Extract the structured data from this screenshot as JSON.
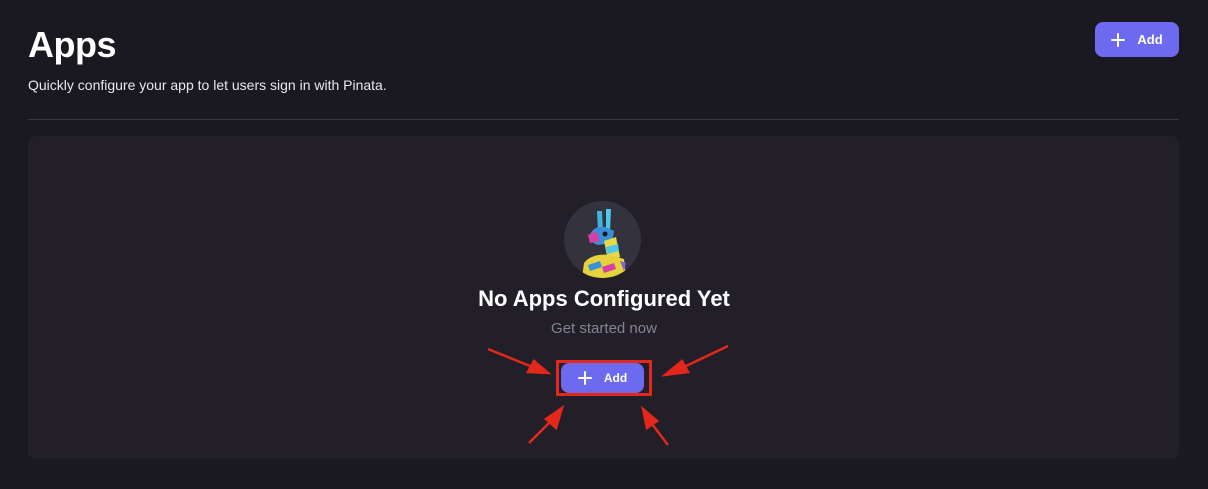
{
  "header": {
    "title": "Apps",
    "subtitle": "Quickly configure your app to let users sign in with Pinata.",
    "add_label": "Add"
  },
  "empty_state": {
    "icon": "pinata-llama-icon",
    "title": "No Apps Configured Yet",
    "subtitle": "Get started now",
    "add_label": "Add"
  },
  "colors": {
    "background": "#1a1820",
    "panel": "#221f29",
    "accent": "#6e6af0",
    "annotation": "#e3271a"
  }
}
